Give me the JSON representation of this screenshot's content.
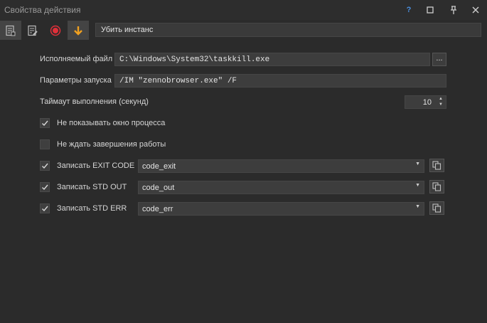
{
  "window": {
    "title": "Свойства действия",
    "help_label": "?",
    "maximize_label": "□",
    "pin_label": "📌",
    "close_label": "✕"
  },
  "toolbar": {
    "icons": [
      "properties-icon",
      "edit-properties-icon",
      "record-icon",
      "arrow-down-icon"
    ],
    "name_value": "Убить инстанс",
    "accent_color": "#f0a020",
    "record_color": "#e0303a"
  },
  "form": {
    "exe_label": "Исполняемый файл",
    "exe_value": "C:\\Windows\\System32\\taskkill.exe",
    "browse_label": "...",
    "params_label": "Параметры запуска",
    "params_value": "/IM \"zennobrowser.exe\" /F",
    "timeout_label": "Таймаут выполнения (секунд)",
    "timeout_value": "10"
  },
  "options": [
    {
      "label": "Не показывать окно процесса",
      "checked": true
    },
    {
      "label": "Не ждать завершения работы",
      "checked": false
    }
  ],
  "outputs": [
    {
      "label": "Записать EXIT CODE",
      "checked": true,
      "value": "code_exit"
    },
    {
      "label": "Записать STD OUT",
      "checked": true,
      "value": "code_out"
    },
    {
      "label": "Записать STD ERR",
      "checked": true,
      "value": "code_err"
    }
  ]
}
